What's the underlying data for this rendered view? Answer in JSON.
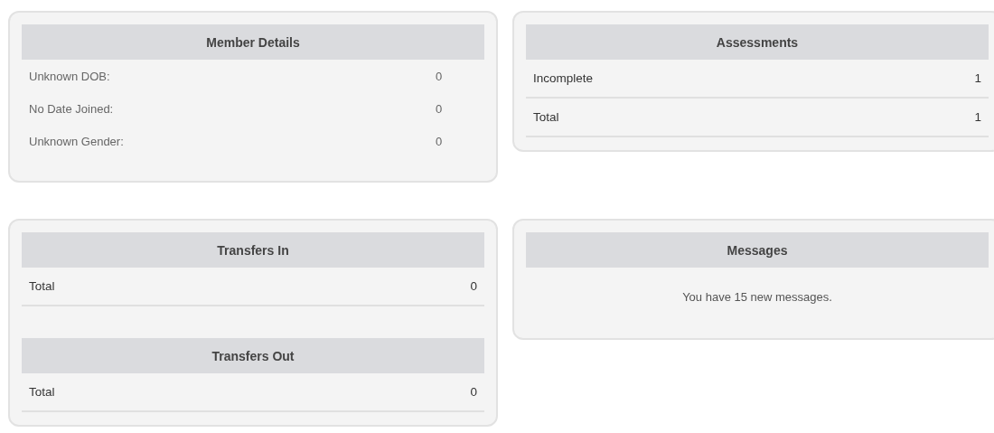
{
  "panels": [
    {
      "sections": [
        {
          "title": "Member Details",
          "kind": "detail",
          "rows": [
            {
              "label": "Unknown DOB:",
              "value": "0"
            },
            {
              "label": "No Date Joined:",
              "value": "0"
            },
            {
              "label": "Unknown Gender:",
              "value": "0"
            }
          ]
        }
      ]
    },
    {
      "sections": [
        {
          "title": "Assessments",
          "kind": "summary",
          "rows": [
            {
              "label": "Incomplete",
              "value": "1"
            },
            {
              "label": "Total",
              "value": "1"
            }
          ]
        }
      ]
    },
    {
      "sections": [
        {
          "title": "Transfers In",
          "kind": "summary",
          "rows": [
            {
              "label": "Total",
              "value": "0"
            }
          ]
        },
        {
          "title": "Transfers Out",
          "kind": "summary",
          "rows": [
            {
              "label": "Total",
              "value": "0"
            }
          ]
        }
      ]
    },
    {
      "sections": [
        {
          "title": "Messages",
          "kind": "message",
          "text": "You have 15 new messages."
        }
      ]
    }
  ]
}
